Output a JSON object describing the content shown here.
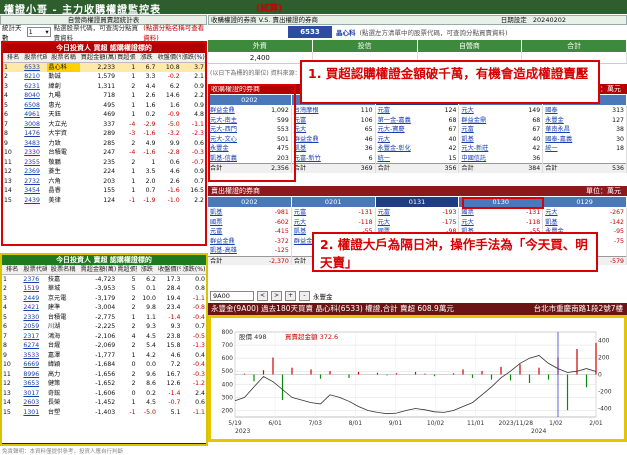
{
  "title": "權證小哥 - 主力收購權證監控表",
  "title_badge": "(試算)",
  "left_subheader": "自營商權證買賣超統計表",
  "stats": {
    "label": "統計天數",
    "days": "1",
    "hint": "點選股票代碼，可查詢分點買賣資料",
    "hint2": "(點選分點名稱可查看資料)"
  },
  "buy_panel": {
    "title": "今日投資人 買超 認購權證標的",
    "columns": [
      "排名",
      "股票代碼",
      "股票名稱",
      "買超金額(萬)",
      "買超張數",
      "漲跌",
      "收盤價(%)",
      "漲跌(%)"
    ],
    "rows": [
      [
        "1",
        "6533",
        "晶心科",
        "2,233",
        "1",
        "6.7",
        "10.8",
        "3.7"
      ],
      [
        "2",
        "8210",
        "勤誠",
        "1,579",
        "1",
        "3.3",
        "-0.2",
        "2.1"
      ],
      [
        "3",
        "6231",
        "緯創",
        "1,311",
        "2",
        "4.4",
        "6.2",
        "0.9"
      ],
      [
        "4",
        "8040",
        "九暘",
        "718",
        "1",
        "2.6",
        "14.6",
        "2.2"
      ],
      [
        "5",
        "6508",
        "惠光",
        "495",
        "1",
        "1.6",
        "1.6",
        "0.9"
      ],
      [
        "6",
        "4961",
        "天鈺",
        "469",
        "1",
        "0.2",
        "-0.9",
        "4.8"
      ],
      [
        "7",
        "3008",
        "大立光",
        "337",
        "-4",
        "-2.9",
        "-5.0",
        "-1.1"
      ],
      [
        "8",
        "1476",
        "大宇資",
        "289",
        "-3",
        "-1.6",
        "-3.2",
        "-2.3"
      ],
      [
        "9",
        "3483",
        "力致",
        "285",
        "2",
        "4.9",
        "9.9",
        "0.6"
      ],
      [
        "10",
        "2330",
        "台積電",
        "247",
        "-4",
        "-1.6",
        "-2.8",
        "-0.3"
      ],
      [
        "11",
        "2355",
        "敬鵬",
        "235",
        "2",
        "1",
        "0.6",
        "-0.7"
      ],
      [
        "12",
        "2369",
        "菱生",
        "224",
        "1",
        "3.5",
        "4.6",
        "0.9"
      ],
      [
        "13",
        "2732",
        "六角",
        "203",
        "1",
        "2.0",
        "2.6",
        "0.7"
      ],
      [
        "14",
        "3454",
        "晶睿",
        "155",
        "1",
        "0.7",
        "-1.6",
        "16.5"
      ],
      [
        "15",
        "2439",
        "美律",
        "124",
        "-1",
        "-1.9",
        "-1.0",
        "2.2"
      ]
    ]
  },
  "sell_panel": {
    "title": "今日投資人 賣超 認購權證標的",
    "columns": [
      "排名",
      "股票代碼",
      "股票名稱",
      "賣超金額(萬)",
      "賣超張數",
      "漲跌",
      "收盤價(%)",
      "漲跌(%)"
    ],
    "rows": [
      [
        "1",
        "2376",
        "技嘉",
        "-4,723",
        "5",
        "6.2",
        "17.3",
        "0.0"
      ],
      [
        "2",
        "1519",
        "華城",
        "-3,953",
        "5",
        "0.1",
        "28.4",
        "0.8"
      ],
      [
        "3",
        "2449",
        "京元電",
        "-3,179",
        "2",
        "10.0",
        "19.4",
        "-1.1"
      ],
      [
        "4",
        "2421",
        "建準",
        "-3,004",
        "2",
        "9.8",
        "23.4",
        "-0.8"
      ],
      [
        "5",
        "2330",
        "台積電",
        "-2,775",
        "1",
        "1.1",
        "-1.4",
        "-0.4"
      ],
      [
        "6",
        "2059",
        "川湖",
        "-2,225",
        "2",
        "9.3",
        "9.3",
        "0.7"
      ],
      [
        "7",
        "2317",
        "鴻海",
        "-2,106",
        "4",
        "4.5",
        "23.8",
        "-0.5"
      ],
      [
        "8",
        "6274",
        "台燿",
        "-2,069",
        "2",
        "5.4",
        "15.8",
        "-1.3"
      ],
      [
        "9",
        "3533",
        "嘉澤",
        "-1,777",
        "1",
        "4.2",
        "4.6",
        "0.4"
      ],
      [
        "10",
        "6669",
        "緯穎",
        "-1,684",
        "0",
        "0.0",
        "7.2",
        "-0.4"
      ],
      [
        "11",
        "8996",
        "高力",
        "-1,656",
        "2",
        "9.6",
        "16.7",
        "-0.3"
      ],
      [
        "12",
        "3653",
        "健策",
        "-1,652",
        "2",
        "8.6",
        "12.6",
        "-1.2"
      ],
      [
        "13",
        "3017",
        "奇鋐",
        "-1,606",
        "0",
        "0.2",
        "-1.4",
        "2.4"
      ],
      [
        "14",
        "2603",
        "長榮",
        "-1,452",
        "1",
        "4.5",
        "-0.7",
        "0.6"
      ],
      [
        "15",
        "1301",
        "台塑",
        "-1,403",
        "-1",
        "-5.0",
        "5.1",
        "-1.1"
      ]
    ]
  },
  "right": {
    "subheader": "收購權證的券商 V.S. 賣出權證的券商",
    "date_label": "日期設定",
    "date": "20240202",
    "code": "6533",
    "stock_name": "晶心科",
    "stock_hint": "(點選左方清單中的股票代碼，可查詢分點買賣資料)",
    "summary_headers": [
      "外資",
      "投信",
      "自營商",
      "合計"
    ],
    "summary_values": [
      "2,400",
      "",
      "",
      ""
    ],
    "small_note": "(以日下為標的的單位) 資料來源：...",
    "buy_section": "收購權證的券商",
    "buy_section_right": "單位：萬元",
    "sell_section": "賣出權證的券商",
    "sell_section_right": "單位：萬元",
    "date_columns": [
      "0202",
      "0201",
      "0131",
      "0130",
      "0129"
    ],
    "buy_brokers": [
      [
        [
          "群益金鼎",
          "1,092"
        ],
        [
          "元大-南主",
          "599"
        ],
        [
          "元大-西門",
          "553"
        ],
        [
          "元大-文心",
          "501"
        ],
        [
          "永豐金",
          "475"
        ],
        [
          "凱基-信義",
          "203"
        ],
        [
          "合計",
          "2,356"
        ]
      ],
      [
        [
          "台灣摩根",
          "110"
        ],
        [
          "元富",
          "106"
        ],
        [
          "元大",
          "65"
        ],
        [
          "群益金鼎",
          "46"
        ],
        [
          "凱基",
          "36"
        ],
        [
          "元富-新竹",
          "6"
        ],
        [
          "合計",
          "369"
        ]
      ],
      [
        [
          "元富",
          "124"
        ],
        [
          "第一金-嘉義",
          "68"
        ],
        [
          "元大-寶慶",
          "67"
        ],
        [
          "元大",
          "40"
        ],
        [
          "永豐金-彰化",
          "42"
        ],
        [
          "統一",
          "15"
        ],
        [
          "合計",
          "356"
        ]
      ],
      [
        [
          "元大",
          "149"
        ],
        [
          "群益金鼎",
          "68"
        ],
        [
          "元富",
          "67"
        ],
        [
          "凱基",
          "40"
        ],
        [
          "元大-新莊",
          "42"
        ],
        [
          "中國信託",
          "36"
        ],
        [
          "合計",
          "384"
        ]
      ],
      [
        [
          "國泰",
          "313"
        ],
        [
          "永豐金",
          "127"
        ],
        [
          "華南永昌",
          "38"
        ],
        [
          "國泰-嘉義",
          "30"
        ],
        [
          "統一",
          "18"
        ],
        [
          "",
          ""
        ],
        [
          "合計",
          "536"
        ]
      ]
    ],
    "sell_brokers": [
      [
        [
          "凱基",
          "-981"
        ],
        [
          "國票",
          "-602"
        ],
        [
          "元富",
          "-415"
        ],
        [
          "群益金鼎",
          "-372"
        ],
        [
          "凱基-高雄",
          "-125"
        ],
        [
          "合計",
          "-2,370"
        ]
      ],
      [
        [
          "元富",
          "-131"
        ],
        [
          "元大",
          "-118"
        ],
        [
          "凱基",
          "-55"
        ],
        [
          "群益金鼎",
          "-43"
        ],
        [
          "",
          ""
        ],
        [
          "合計",
          "-347"
        ]
      ],
      [
        [
          "元富",
          "-193"
        ],
        [
          "元大",
          "-175"
        ],
        [
          "國票",
          "-98"
        ],
        [
          "永豐金",
          "-44"
        ],
        [
          "",
          ""
        ],
        [
          "合計",
          "-510"
        ]
      ],
      [
        [
          "國票",
          "-131"
        ],
        [
          "元大",
          "-118"
        ],
        [
          "凱基",
          "-55"
        ],
        [
          "",
          ""
        ],
        [
          "",
          ""
        ],
        [
          "合計",
          "-304"
        ]
      ],
      [
        [
          "元大",
          "-267"
        ],
        [
          "凱基",
          "-142"
        ],
        [
          "永豐金",
          "-95"
        ],
        [
          "群益金鼎",
          "-75"
        ],
        [
          "",
          ""
        ],
        [
          "合計",
          "-579"
        ]
      ]
    ]
  },
  "annotations": {
    "one": "1. 買超認購權證金額破千萬，有機會造成權證賣壓",
    "two": "2. 權證大戶為隔日沖，操作手法為「今天買、明天賣」"
  },
  "chart_tools": {
    "combo": "9A00",
    "prev": "<",
    "next": ">",
    "zoom_in": "+",
    "zoom_out": "-",
    "label": "永豐金"
  },
  "chart_header": "永豐金(9A00) 過去180天買賣 晶心科(6533) 權證,合計 賣超 608.9萬元",
  "chart_header_right": "台北市重慶南路1段2號7樓",
  "chart_data": {
    "type": "line",
    "series": [
      {
        "name": "股價 498",
        "color": "#333333",
        "values": [
          275,
          300,
          380,
          460,
          420,
          360,
          300,
          280,
          260,
          250,
          320,
          300,
          270,
          230,
          200,
          185,
          175,
          180,
          200,
          215,
          205,
          190,
          185,
          200,
          230,
          260,
          320,
          380,
          450,
          500,
          560,
          600,
          620,
          560,
          520,
          490,
          500,
          520,
          498
        ]
      },
      {
        "name": "買賣超金額 372.6",
        "color": "#d00000",
        "values": [
          0,
          10,
          -80,
          50,
          200,
          -300,
          80,
          0,
          60,
          -50,
          40,
          0,
          -40,
          30,
          0,
          20,
          -10,
          15,
          0,
          30,
          10,
          -20,
          0,
          15,
          60,
          -40,
          40,
          -60,
          90,
          -70,
          120,
          -100,
          80,
          -60,
          200,
          -420,
          300,
          -150,
          372.6
        ]
      }
    ],
    "x_ticks": [
      "5/19",
      "6/01",
      "7/03",
      "8/01",
      "9/01",
      "10/02",
      "11/01",
      "2023/11/28",
      "1/02",
      "2/01"
    ],
    "year_labels": [
      "2023",
      "2024"
    ],
    "y_left_ticks": [
      "200",
      "300",
      "400",
      "500",
      "600",
      "700",
      "800"
    ],
    "y_right_ticks": [
      "-400",
      "-200",
      "0",
      "200",
      "400"
    ],
    "y_left_range": [
      150,
      800
    ],
    "y_right_range": [
      -500,
      500
    ],
    "grid": true,
    "legend": "top-left",
    "marker_index": 34
  },
  "footer": "免責聲明：本資料僅提供參考，投資人應自行判斷"
}
